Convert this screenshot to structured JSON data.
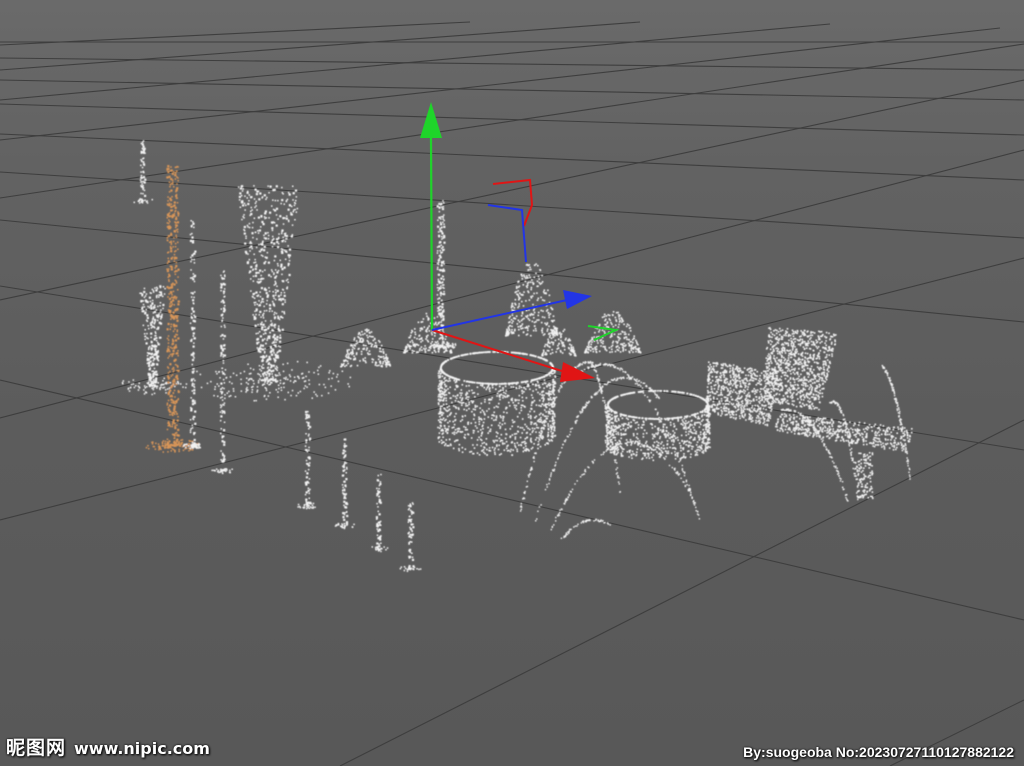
{
  "viewport": {
    "background": "#5b5b5b",
    "grid_color": "#3e3e3e",
    "particle_color": "#f2f2f2",
    "selected_particle_color": "#d89558"
  },
  "gizmo": {
    "y_axis_color": "#1fd42a",
    "x_axis_color": "#e01515",
    "z_axis_color": "#2235e6",
    "icons": [
      "move-gizmo-y-arrow-icon",
      "move-gizmo-x-arrow-icon",
      "move-gizmo-z-arrow-icon",
      "plane-handle-icon"
    ]
  },
  "watermark": {
    "site_logo": "昵图网",
    "site_url": "www.nipic.com",
    "credit": "By:suogeoba No:20230727110127882122"
  }
}
